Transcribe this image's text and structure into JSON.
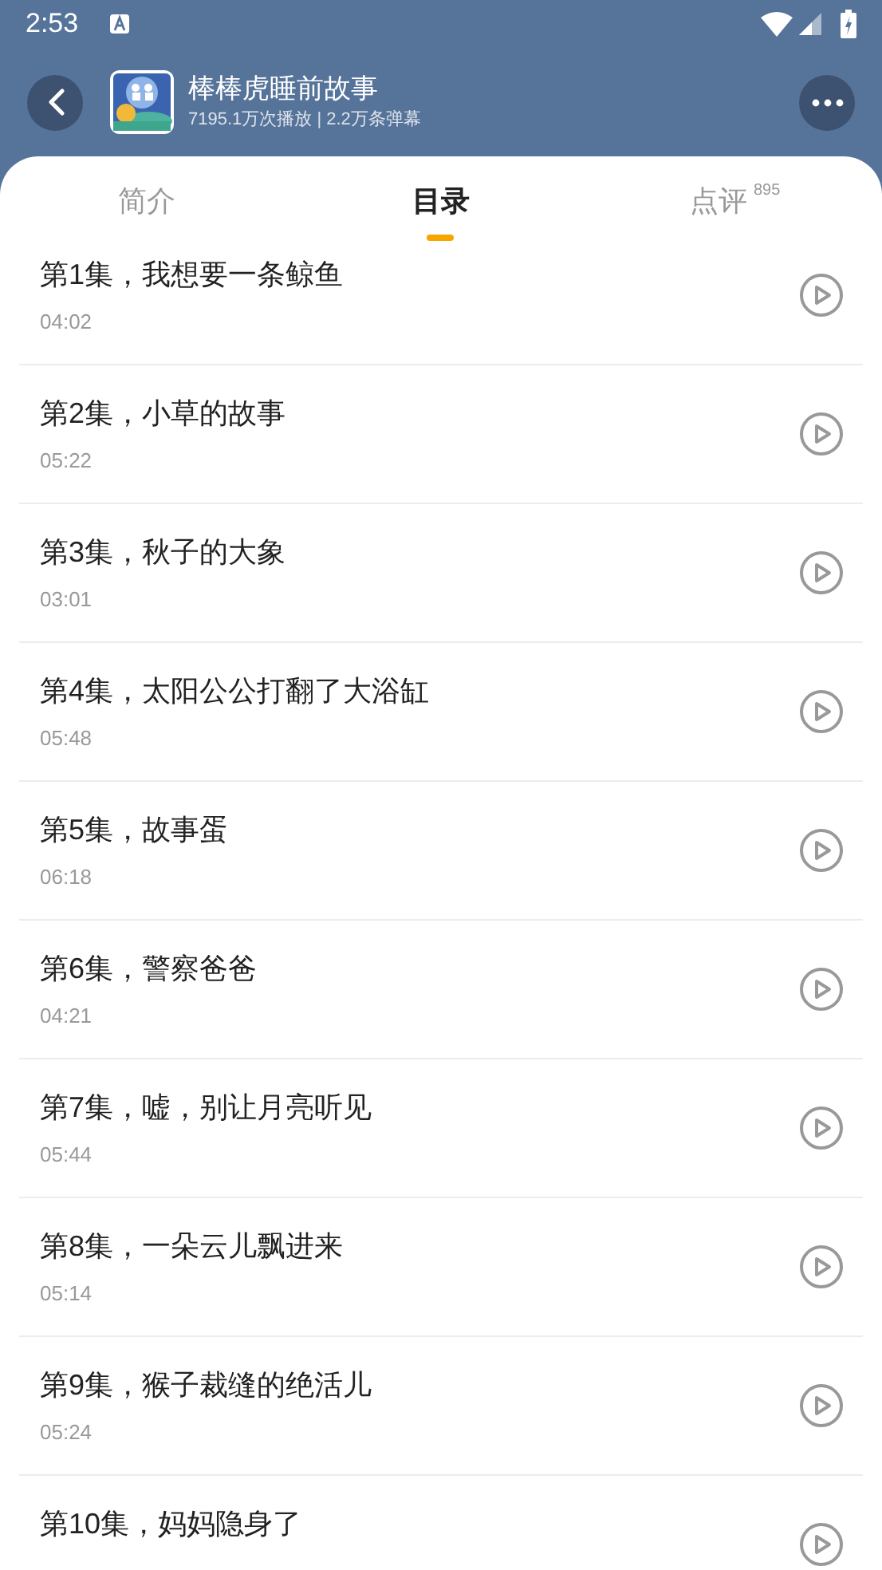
{
  "status_bar": {
    "time": "2:53"
  },
  "header": {
    "title": "棒棒虎睡前故事",
    "subtitle": "7195.1万次播放 | 2.2万条弹幕"
  },
  "tabs": [
    {
      "label": "简介",
      "selected": false
    },
    {
      "label": "目录",
      "selected": true
    },
    {
      "label": "点评",
      "badge": "895",
      "selected": false
    }
  ],
  "episodes": [
    {
      "title": "第1集，我想要一条鲸鱼",
      "duration": "04:02"
    },
    {
      "title": "第2集，小草的故事",
      "duration": "05:22"
    },
    {
      "title": "第3集，秋子的大象",
      "duration": "03:01"
    },
    {
      "title": "第4集，太阳公公打翻了大浴缸",
      "duration": "05:48"
    },
    {
      "title": "第5集，故事蛋",
      "duration": "06:18"
    },
    {
      "title": "第6集，警察爸爸",
      "duration": "04:21"
    },
    {
      "title": "第7集，嘘，别让月亮听见",
      "duration": "05:44"
    },
    {
      "title": "第8集，一朵云儿飘进来",
      "duration": "05:14"
    },
    {
      "title": "第9集，猴子裁缝的绝活儿",
      "duration": "05:24"
    },
    {
      "title": "第10集，妈妈隐身了"
    }
  ]
}
